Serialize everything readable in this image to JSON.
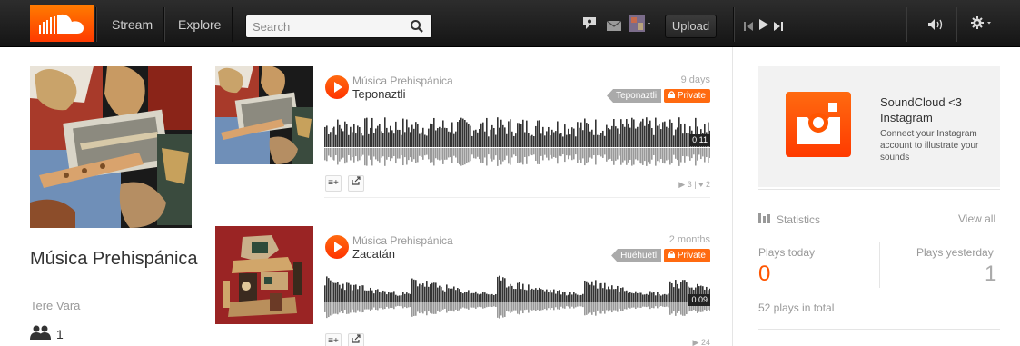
{
  "header": {
    "nav": [
      "Stream",
      "Explore"
    ],
    "search_placeholder": "Search",
    "upload_label": "Upload"
  },
  "set": {
    "title": "Música Prehispánica",
    "user": "Tere Vara",
    "followers": "1"
  },
  "tracks": [
    {
      "user": "Música Prehispánica",
      "title": "Teponaztli",
      "age": "9 days",
      "tag": "Teponaztli",
      "privacy": "Private",
      "duration": "0.11",
      "plays": "3",
      "likes": "2"
    },
    {
      "user": "Música Prehispánica",
      "title": "Zacatán",
      "age": "2 months",
      "tag": "Huéhuetl",
      "privacy": "Private",
      "duration": "0.09",
      "plays": "24"
    }
  ],
  "sidebar": {
    "promo_title": "SoundCloud <3 Instagram",
    "promo_desc": "Connect your Instagram account to illustrate your sounds",
    "stats_label": "Statistics",
    "view_all": "View all",
    "plays_today_label": "Plays today",
    "plays_today_value": "0",
    "plays_yesterday_label": "Plays yesterday",
    "plays_yesterday_value": "1",
    "plays_total": "52 plays in total"
  },
  "colors": {
    "accent": "#ff5500",
    "topbar": "#1f1f1f",
    "wave": "#333333",
    "wave_reflection": "#999999"
  }
}
